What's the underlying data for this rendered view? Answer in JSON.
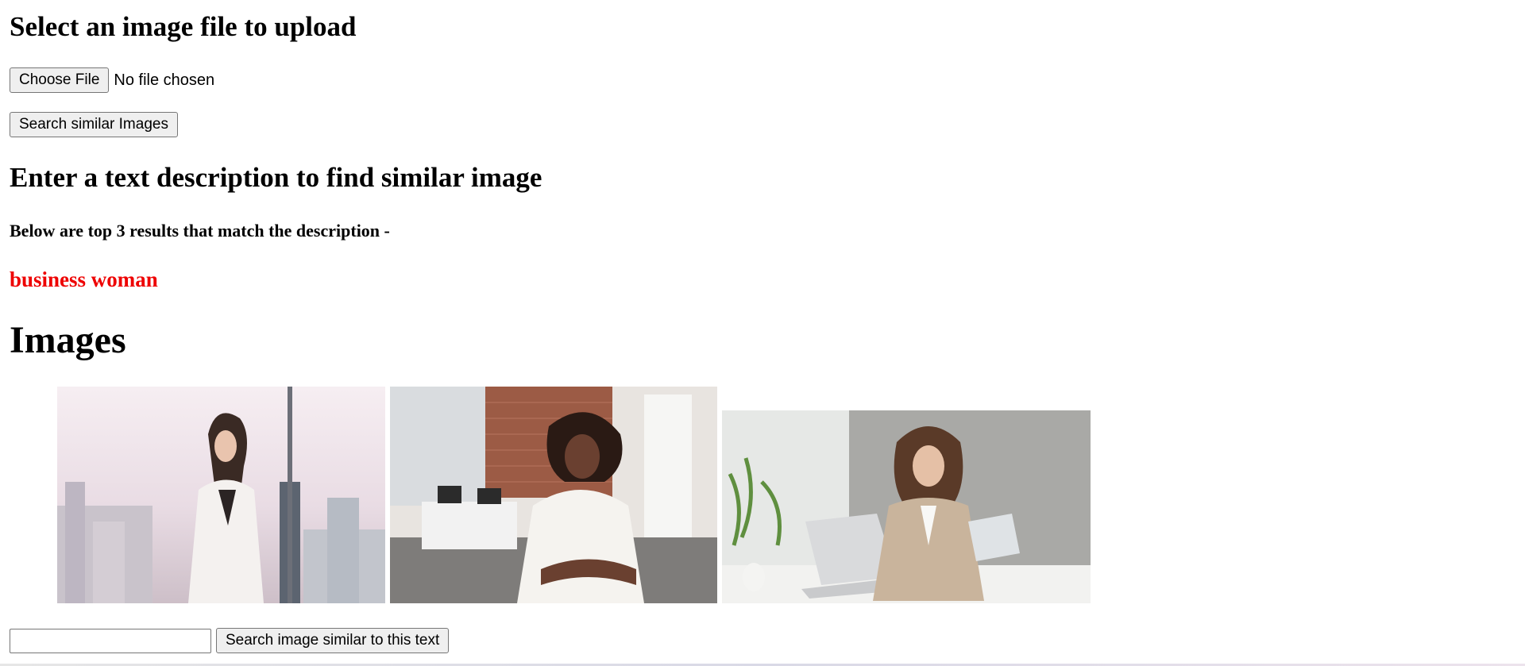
{
  "upload_section": {
    "heading": "Select an image file to upload",
    "choose_file_label": "Choose File",
    "file_status": "No file chosen",
    "search_button_label": "Search similar Images"
  },
  "text_section": {
    "heading": "Enter a text description to find similar image",
    "results_caption": "Below are top 3 results that match the description -",
    "query": "business woman",
    "query_color": "#ee0000"
  },
  "images_section": {
    "heading": "Images",
    "results": [
      {
        "alt": "Businesswoman in white suit looking out office window over city"
      },
      {
        "alt": "Smiling woman with arms crossed in open-plan office"
      },
      {
        "alt": "Woman in beige blazer holding tablet next to laptop at desk"
      }
    ]
  },
  "search_form": {
    "input_value": "",
    "input_placeholder": "",
    "submit_label": "Search image similar to this text"
  }
}
